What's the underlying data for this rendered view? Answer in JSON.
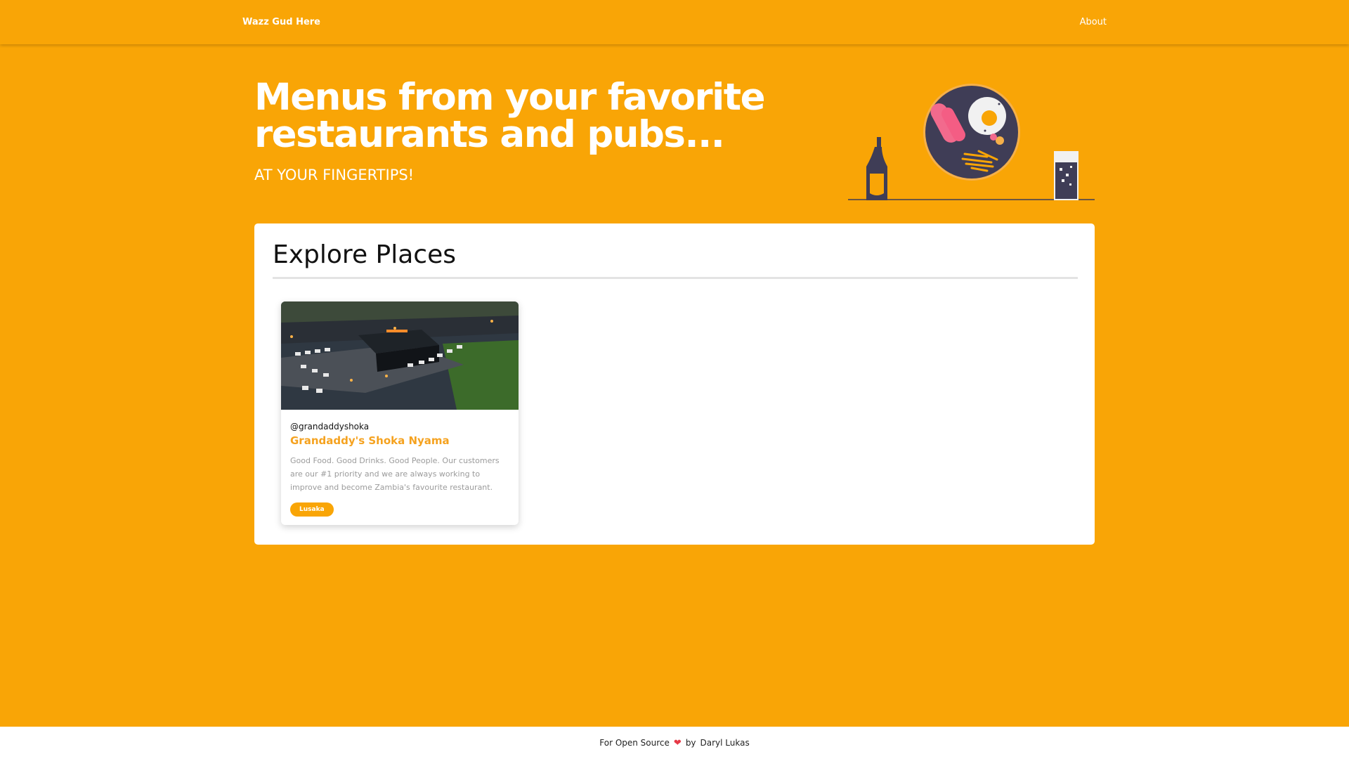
{
  "nav": {
    "brand": "Wazz Gud Here",
    "about": "About"
  },
  "hero": {
    "title": "Menus from your favorite restaurants and pubs...",
    "subtitle": "AT YOUR FINGERTIPS!",
    "illustration": "food-and-drinks-illustration"
  },
  "explore": {
    "title": "Explore Places",
    "places": [
      {
        "handle": "@grandaddyshoka",
        "name": "Grandaddy's Shoka Nyama",
        "description": "Good Food. Good Drinks. Good People. Our customers are our #1 priority and we are always working to improve and become Zambia's favourite restaurant.",
        "location": "Lusaka",
        "image": "restaurant-aerial-photo"
      }
    ]
  },
  "footer": {
    "prefix": "For Open Source",
    "heart_icon": "heart-icon",
    "by": "by",
    "author": "Daryl Lukas"
  },
  "colors": {
    "accent": "#f9a506",
    "title_orange": "#f5a21f",
    "heart": "#e63946",
    "plate": "#3f3d56"
  }
}
